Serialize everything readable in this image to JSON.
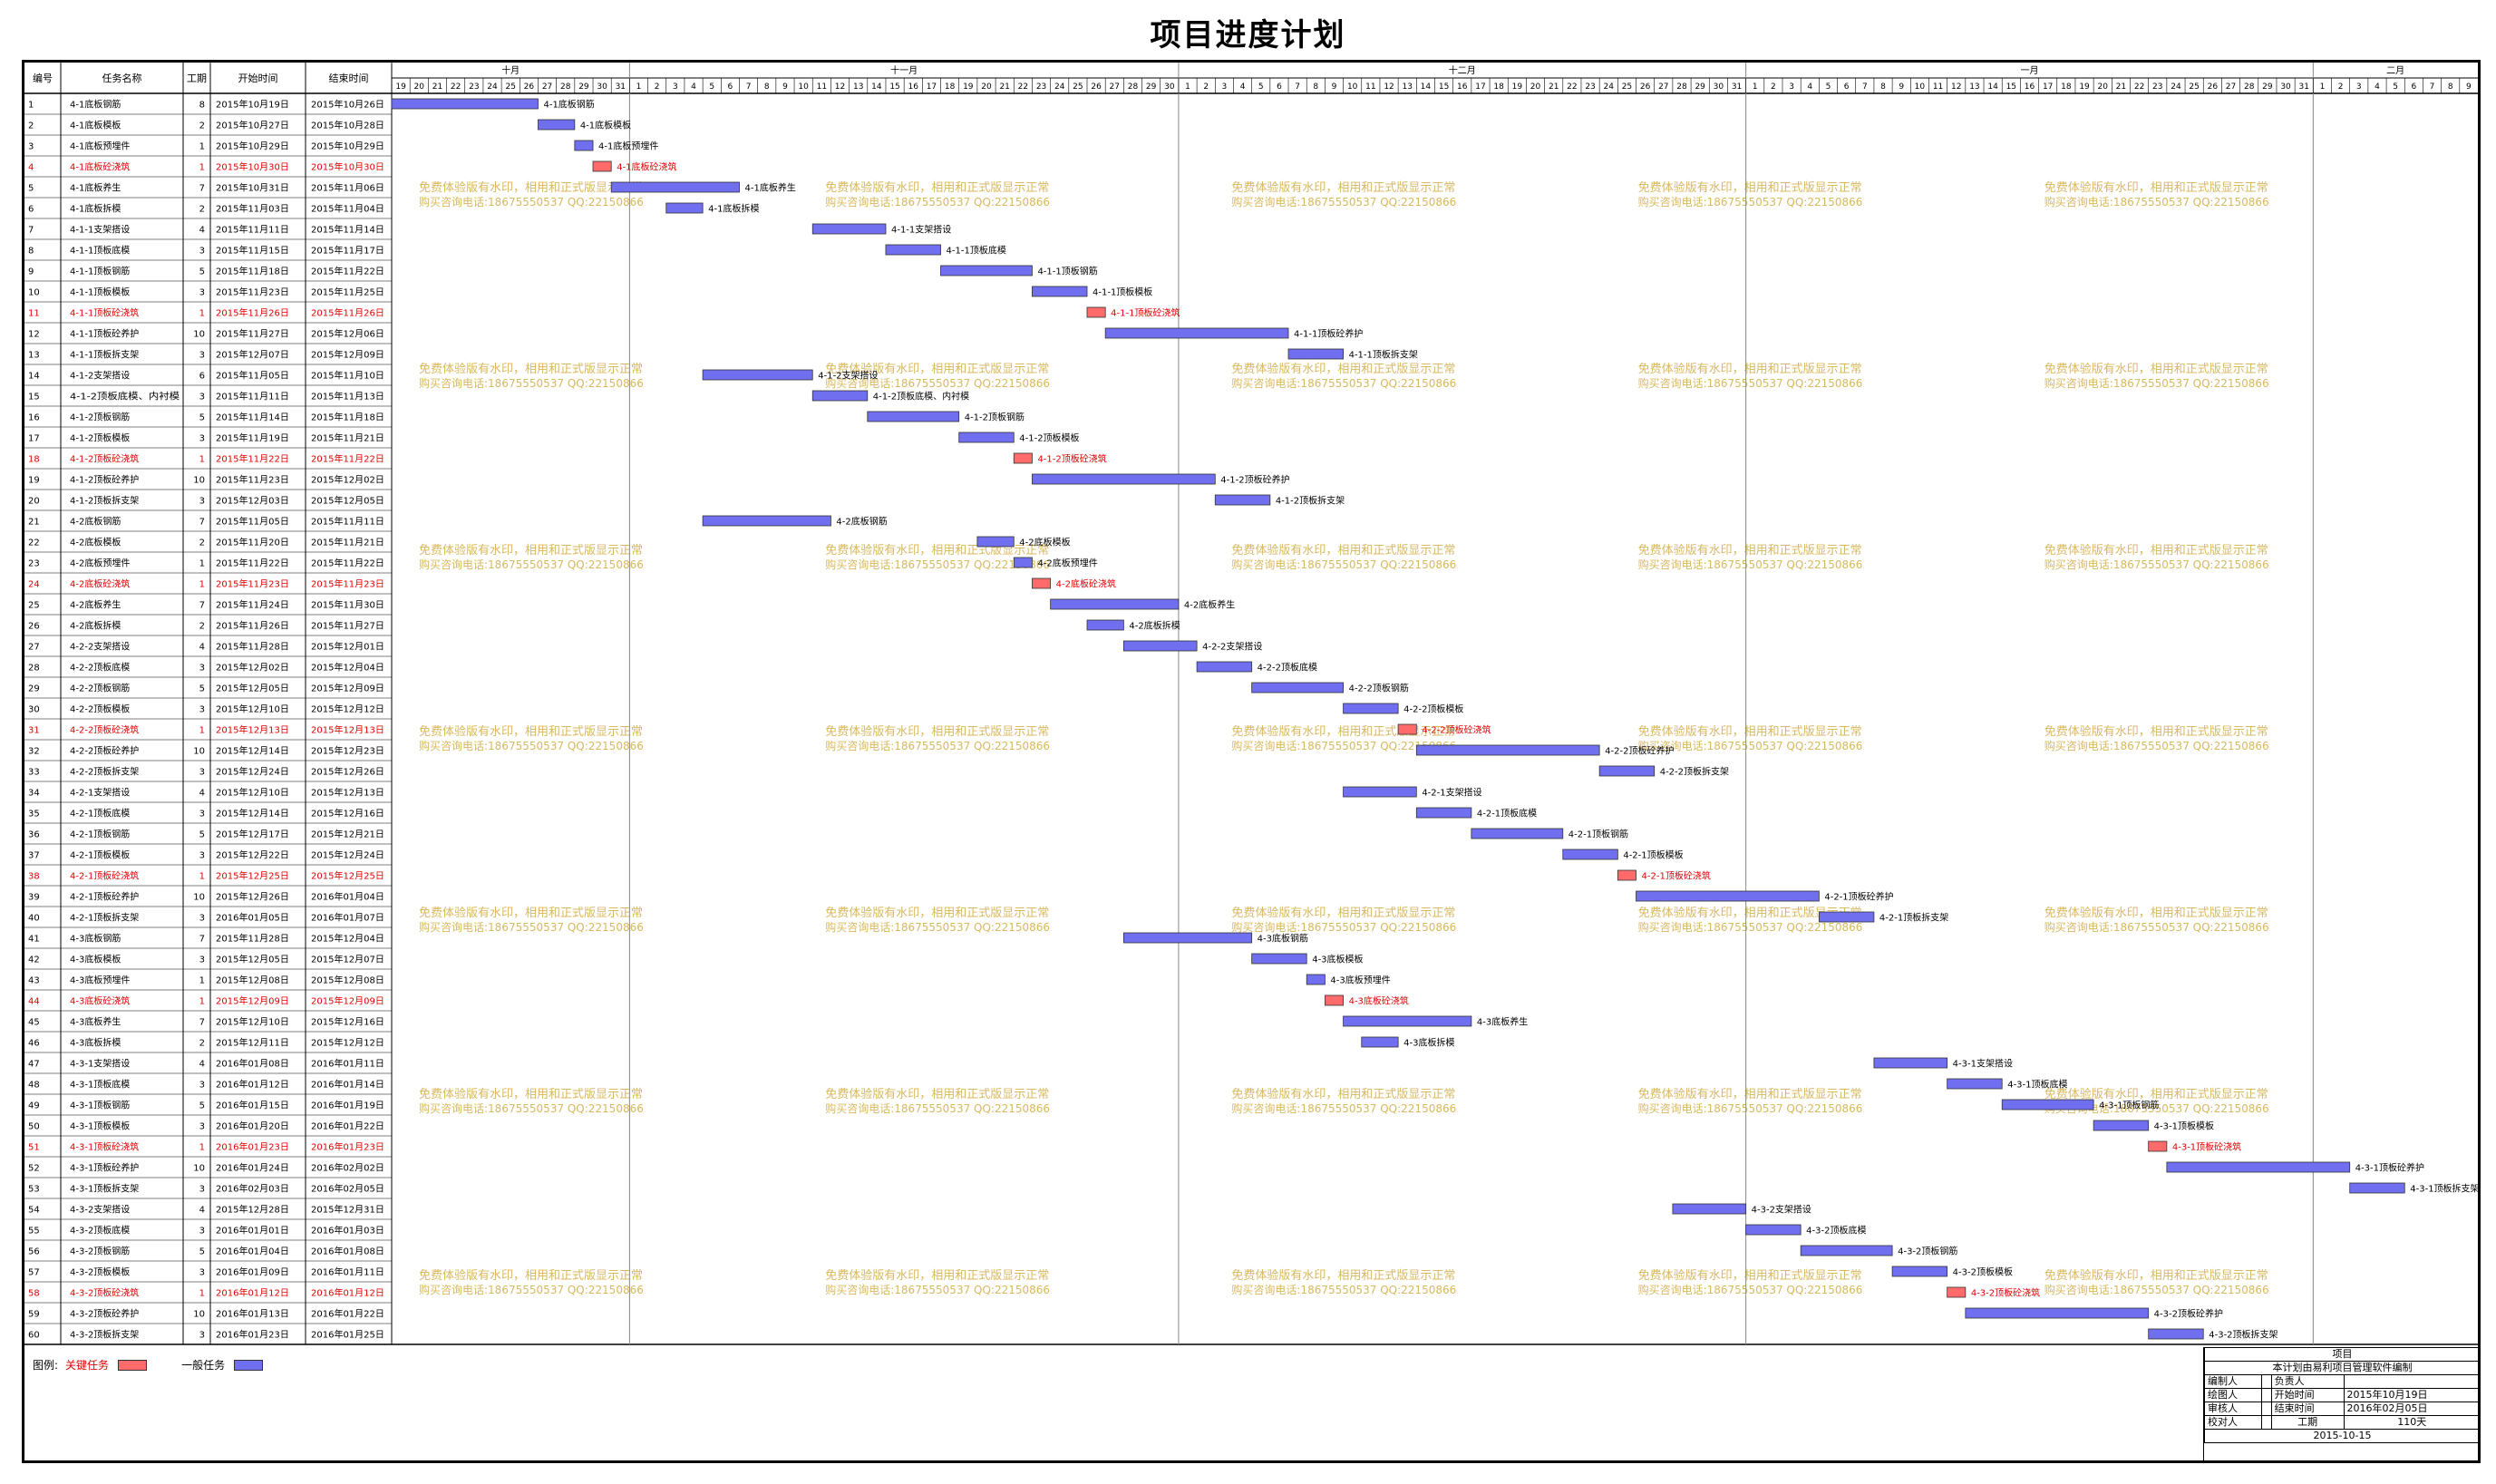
{
  "title": "项目进度计划",
  "header": {
    "col_id": "编号",
    "col_name": "任务名称",
    "col_dur": "工期",
    "col_start": "开始时间",
    "col_end": "结束时间"
  },
  "colors": {
    "critical": "#ff6b6b",
    "normal": "#6f6ff0",
    "critical_text": "#e00000",
    "watermark": "#d8b860"
  },
  "watermark": {
    "line1": "免费体验版有水印，相用和正式版显示正常",
    "line2": "购买咨询电话:18675550537 QQ:22150866"
  },
  "chart_data": {
    "type": "gantt",
    "timeline_start": "2015-10-19",
    "timeline_end": "2016-02-09",
    "months": [
      {
        "label": "十月",
        "start": "2015-10-19",
        "end": "2015-10-31"
      },
      {
        "label": "十一月",
        "start": "2015-11-01",
        "end": "2015-11-30"
      },
      {
        "label": "十二月",
        "start": "2015-12-01",
        "end": "2015-12-31"
      },
      {
        "label": "一月",
        "start": "2016-01-01",
        "end": "2016-01-31"
      },
      {
        "label": "二月",
        "start": "2016-02-01",
        "end": "2016-02-09"
      }
    ],
    "tasks": [
      {
        "id": "1",
        "name": "4-1底板钢筋",
        "dur": 8,
        "start": "2015年10月19日",
        "end": "2015年10月26日",
        "critical": false
      },
      {
        "id": "2",
        "name": "4-1底板模板",
        "dur": 2,
        "start": "2015年10月27日",
        "end": "2015年10月28日",
        "critical": false
      },
      {
        "id": "3",
        "name": "4-1底板预埋件",
        "dur": 1,
        "start": "2015年10月29日",
        "end": "2015年10月29日",
        "critical": false
      },
      {
        "id": "4",
        "name": "4-1底板砼浇筑",
        "dur": 1,
        "start": "2015年10月30日",
        "end": "2015年10月30日",
        "critical": true
      },
      {
        "id": "5",
        "name": "4-1底板养生",
        "dur": 7,
        "start": "2015年10月31日",
        "end": "2015年11月06日",
        "critical": false
      },
      {
        "id": "6",
        "name": "4-1底板拆模",
        "dur": 2,
        "start": "2015年11月03日",
        "end": "2015年11月04日",
        "critical": false
      },
      {
        "id": "7",
        "name": "4-1-1支架搭设",
        "dur": 4,
        "start": "2015年11月11日",
        "end": "2015年11月14日",
        "critical": false
      },
      {
        "id": "8",
        "name": "4-1-1顶板底模",
        "dur": 3,
        "start": "2015年11月15日",
        "end": "2015年11月17日",
        "critical": false
      },
      {
        "id": "9",
        "name": "4-1-1顶板钢筋",
        "dur": 5,
        "start": "2015年11月18日",
        "end": "2015年11月22日",
        "critical": false
      },
      {
        "id": "10",
        "name": "4-1-1顶板模板",
        "dur": 3,
        "start": "2015年11月23日",
        "end": "2015年11月25日",
        "critical": false
      },
      {
        "id": "11",
        "name": "4-1-1顶板砼浇筑",
        "dur": 1,
        "start": "2015年11月26日",
        "end": "2015年11月26日",
        "critical": true
      },
      {
        "id": "12",
        "name": "4-1-1顶板砼养护",
        "dur": 10,
        "start": "2015年11月27日",
        "end": "2015年12月06日",
        "critical": false
      },
      {
        "id": "13",
        "name": "4-1-1顶板拆支架",
        "dur": 3,
        "start": "2015年12月07日",
        "end": "2015年12月09日",
        "critical": false
      },
      {
        "id": "14",
        "name": "4-1-2支架搭设",
        "dur": 6,
        "start": "2015年11月05日",
        "end": "2015年11月10日",
        "critical": false
      },
      {
        "id": "15",
        "name": "4-1-2顶板底模、内衬模",
        "dur": 3,
        "start": "2015年11月11日",
        "end": "2015年11月13日",
        "critical": false
      },
      {
        "id": "16",
        "name": "4-1-2顶板钢筋",
        "dur": 5,
        "start": "2015年11月14日",
        "end": "2015年11月18日",
        "critical": false
      },
      {
        "id": "17",
        "name": "4-1-2顶板模板",
        "dur": 3,
        "start": "2015年11月19日",
        "end": "2015年11月21日",
        "critical": false
      },
      {
        "id": "18",
        "name": "4-1-2顶板砼浇筑",
        "dur": 1,
        "start": "2015年11月22日",
        "end": "2015年11月22日",
        "critical": true
      },
      {
        "id": "19",
        "name": "4-1-2顶板砼养护",
        "dur": 10,
        "start": "2015年11月23日",
        "end": "2015年12月02日",
        "critical": false
      },
      {
        "id": "20",
        "name": "4-1-2顶板拆支架",
        "dur": 3,
        "start": "2015年12月03日",
        "end": "2015年12月05日",
        "critical": false
      },
      {
        "id": "21",
        "name": "4-2底板钢筋",
        "dur": 7,
        "start": "2015年11月05日",
        "end": "2015年11月11日",
        "critical": false
      },
      {
        "id": "22",
        "name": "4-2底板模板",
        "dur": 2,
        "start": "2015年11月20日",
        "end": "2015年11月21日",
        "critical": false
      },
      {
        "id": "23",
        "name": "4-2底板预埋件",
        "dur": 1,
        "start": "2015年11月22日",
        "end": "2015年11月22日",
        "critical": false
      },
      {
        "id": "24",
        "name": "4-2底板砼浇筑",
        "dur": 1,
        "start": "2015年11月23日",
        "end": "2015年11月23日",
        "critical": true
      },
      {
        "id": "25",
        "name": "4-2底板养生",
        "dur": 7,
        "start": "2015年11月24日",
        "end": "2015年11月30日",
        "critical": false
      },
      {
        "id": "26",
        "name": "4-2底板拆模",
        "dur": 2,
        "start": "2015年11月26日",
        "end": "2015年11月27日",
        "critical": false
      },
      {
        "id": "27",
        "name": "4-2-2支架搭设",
        "dur": 4,
        "start": "2015年11月28日",
        "end": "2015年12月01日",
        "critical": false
      },
      {
        "id": "28",
        "name": "4-2-2顶板底模",
        "dur": 3,
        "start": "2015年12月02日",
        "end": "2015年12月04日",
        "critical": false
      },
      {
        "id": "29",
        "name": "4-2-2顶板钢筋",
        "dur": 5,
        "start": "2015年12月05日",
        "end": "2015年12月09日",
        "critical": false
      },
      {
        "id": "30",
        "name": "4-2-2顶板模板",
        "dur": 3,
        "start": "2015年12月10日",
        "end": "2015年12月12日",
        "critical": false
      },
      {
        "id": "31",
        "name": "4-2-2顶板砼浇筑",
        "dur": 1,
        "start": "2015年12月13日",
        "end": "2015年12月13日",
        "critical": true
      },
      {
        "id": "32",
        "name": "4-2-2顶板砼养护",
        "dur": 10,
        "start": "2015年12月14日",
        "end": "2015年12月23日",
        "critical": false
      },
      {
        "id": "33",
        "name": "4-2-2顶板拆支架",
        "dur": 3,
        "start": "2015年12月24日",
        "end": "2015年12月26日",
        "critical": false
      },
      {
        "id": "34",
        "name": "4-2-1支架搭设",
        "dur": 4,
        "start": "2015年12月10日",
        "end": "2015年12月13日",
        "critical": false
      },
      {
        "id": "35",
        "name": "4-2-1顶板底模",
        "dur": 3,
        "start": "2015年12月14日",
        "end": "2015年12月16日",
        "critical": false
      },
      {
        "id": "36",
        "name": "4-2-1顶板钢筋",
        "dur": 5,
        "start": "2015年12月17日",
        "end": "2015年12月21日",
        "critical": false
      },
      {
        "id": "37",
        "name": "4-2-1顶板模板",
        "dur": 3,
        "start": "2015年12月22日",
        "end": "2015年12月24日",
        "critical": false
      },
      {
        "id": "38",
        "name": "4-2-1顶板砼浇筑",
        "dur": 1,
        "start": "2015年12月25日",
        "end": "2015年12月25日",
        "critical": true
      },
      {
        "id": "39",
        "name": "4-2-1顶板砼养护",
        "dur": 10,
        "start": "2015年12月26日",
        "end": "2016年01月04日",
        "critical": false
      },
      {
        "id": "40",
        "name": "4-2-1顶板拆支架",
        "dur": 3,
        "start": "2016年01月05日",
        "end": "2016年01月07日",
        "critical": false
      },
      {
        "id": "41",
        "name": "4-3底板钢筋",
        "dur": 7,
        "start": "2015年11月28日",
        "end": "2015年12月04日",
        "critical": false
      },
      {
        "id": "42",
        "name": "4-3底板模板",
        "dur": 3,
        "start": "2015年12月05日",
        "end": "2015年12月07日",
        "critical": false
      },
      {
        "id": "43",
        "name": "4-3底板预埋件",
        "dur": 1,
        "start": "2015年12月08日",
        "end": "2015年12月08日",
        "critical": false
      },
      {
        "id": "44",
        "name": "4-3底板砼浇筑",
        "dur": 1,
        "start": "2015年12月09日",
        "end": "2015年12月09日",
        "critical": true
      },
      {
        "id": "45",
        "name": "4-3底板养生",
        "dur": 7,
        "start": "2015年12月10日",
        "end": "2015年12月16日",
        "critical": false
      },
      {
        "id": "46",
        "name": "4-3底板拆模",
        "dur": 2,
        "start": "2015年12月11日",
        "end": "2015年12月12日",
        "critical": false
      },
      {
        "id": "47",
        "name": "4-3-1支架搭设",
        "dur": 4,
        "start": "2016年01月08日",
        "end": "2016年01月11日",
        "critical": false
      },
      {
        "id": "48",
        "name": "4-3-1顶板底模",
        "dur": 3,
        "start": "2016年01月12日",
        "end": "2016年01月14日",
        "critical": false
      },
      {
        "id": "49",
        "name": "4-3-1顶板钢筋",
        "dur": 5,
        "start": "2016年01月15日",
        "end": "2016年01月19日",
        "critical": false
      },
      {
        "id": "50",
        "name": "4-3-1顶板模板",
        "dur": 3,
        "start": "2016年01月20日",
        "end": "2016年01月22日",
        "critical": false
      },
      {
        "id": "51",
        "name": "4-3-1顶板砼浇筑",
        "dur": 1,
        "start": "2016年01月23日",
        "end": "2016年01月23日",
        "critical": true
      },
      {
        "id": "52",
        "name": "4-3-1顶板砼养护",
        "dur": 10,
        "start": "2016年01月24日",
        "end": "2016年02月02日",
        "critical": false
      },
      {
        "id": "53",
        "name": "4-3-1顶板拆支架",
        "dur": 3,
        "start": "2016年02月03日",
        "end": "2016年02月05日",
        "critical": false
      },
      {
        "id": "54",
        "name": "4-3-2支架搭设",
        "dur": 4,
        "start": "2015年12月28日",
        "end": "2015年12月31日",
        "critical": false
      },
      {
        "id": "55",
        "name": "4-3-2顶板底模",
        "dur": 3,
        "start": "2016年01月01日",
        "end": "2016年01月03日",
        "critical": false
      },
      {
        "id": "56",
        "name": "4-3-2顶板钢筋",
        "dur": 5,
        "start": "2016年01月04日",
        "end": "2016年01月08日",
        "critical": false
      },
      {
        "id": "57",
        "name": "4-3-2顶板模板",
        "dur": 3,
        "start": "2016年01月09日",
        "end": "2016年01月11日",
        "critical": false
      },
      {
        "id": "58",
        "name": "4-3-2顶板砼浇筑",
        "dur": 1,
        "start": "2016年01月12日",
        "end": "2016年01月12日",
        "critical": true
      },
      {
        "id": "59",
        "name": "4-3-2顶板砼养护",
        "dur": 10,
        "start": "2016年01月13日",
        "end": "2016年01月22日",
        "critical": false
      },
      {
        "id": "60",
        "name": "4-3-2顶板拆支架",
        "dur": 3,
        "start": "2016年01月23日",
        "end": "2016年01月25日",
        "critical": false
      }
    ]
  },
  "legend": {
    "prefix": "图例:",
    "critical_label": "关键任务",
    "normal_label": "一般任务"
  },
  "info": {
    "project_label": "项目",
    "note": "本计划由易利项目管理软件编制",
    "compiler_label": "编制人",
    "owner_label": "负责人",
    "drafter_label": "绘图人",
    "start_label": "开始时间",
    "start_value": "2015年10月19日",
    "reviewer_label": "审核人",
    "end_label": "结束时间",
    "end_value": "2016年02月05日",
    "checker_label": "校对人",
    "duration_label": "工期",
    "duration_value": "110天",
    "date": "2015-10-15"
  }
}
